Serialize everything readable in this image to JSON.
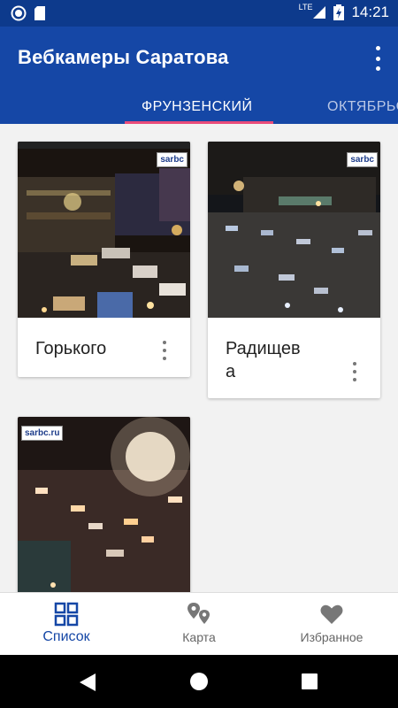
{
  "status_bar": {
    "time": "14:21",
    "network": "LTE"
  },
  "app_bar": {
    "title": "Вебкамеры Саратова",
    "overflow_icon": "more-vert-icon"
  },
  "tabs": [
    {
      "label": "ФРУНЗЕНСКИЙ",
      "active": true
    },
    {
      "label": "ОКТЯБРЬСКИЙ",
      "active": false
    }
  ],
  "cameras": [
    {
      "title": "Горького",
      "watermark": "sarbc",
      "menu_icon": "more-vert-icon"
    },
    {
      "title": "Радищев\nа",
      "watermark": "sarbc",
      "menu_icon": "more-vert-icon"
    },
    {
      "title": "",
      "watermark": "sarbc.ru",
      "menu_icon": "more-vert-icon"
    }
  ],
  "bottom_nav": [
    {
      "label": "Список",
      "icon": "grid-icon",
      "active": true
    },
    {
      "label": "Карта",
      "icon": "map-pins-icon",
      "active": false
    },
    {
      "label": "Избранное",
      "icon": "heart-icon",
      "active": false
    }
  ],
  "colors": {
    "primary": "#1547a6",
    "status_bar": "#0d3a8c",
    "tab_indicator": "#e94b7a",
    "background": "#f2f2f2"
  }
}
